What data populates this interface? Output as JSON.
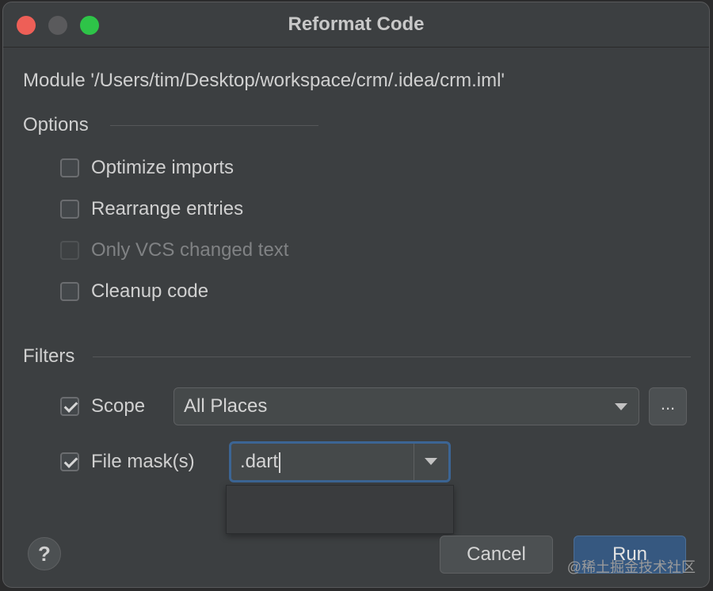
{
  "window": {
    "title": "Reformat Code"
  },
  "module_text": "Module '/Users/tim/Desktop/workspace/crm/.idea/crm.iml'",
  "options": {
    "label": "Options",
    "items": [
      {
        "label": "Optimize imports",
        "checked": false,
        "enabled": true
      },
      {
        "label": "Rearrange entries",
        "checked": false,
        "enabled": true
      },
      {
        "label": "Only VCS changed text",
        "checked": false,
        "enabled": false
      },
      {
        "label": "Cleanup code",
        "checked": false,
        "enabled": true
      }
    ]
  },
  "filters": {
    "label": "Filters",
    "scope": {
      "label": "Scope",
      "checked": true,
      "value": "All Places",
      "browse_label": "..."
    },
    "file_mask": {
      "label": "File mask(s)",
      "checked": true,
      "value": ".dart"
    }
  },
  "buttons": {
    "help": "?",
    "cancel": "Cancel",
    "run": "Run"
  },
  "watermark": "@稀土掘金技术社区",
  "colors": {
    "accent": "#3c6594",
    "run_button": "#365880",
    "close": "#ee5f57",
    "maximize": "#2ec448"
  }
}
